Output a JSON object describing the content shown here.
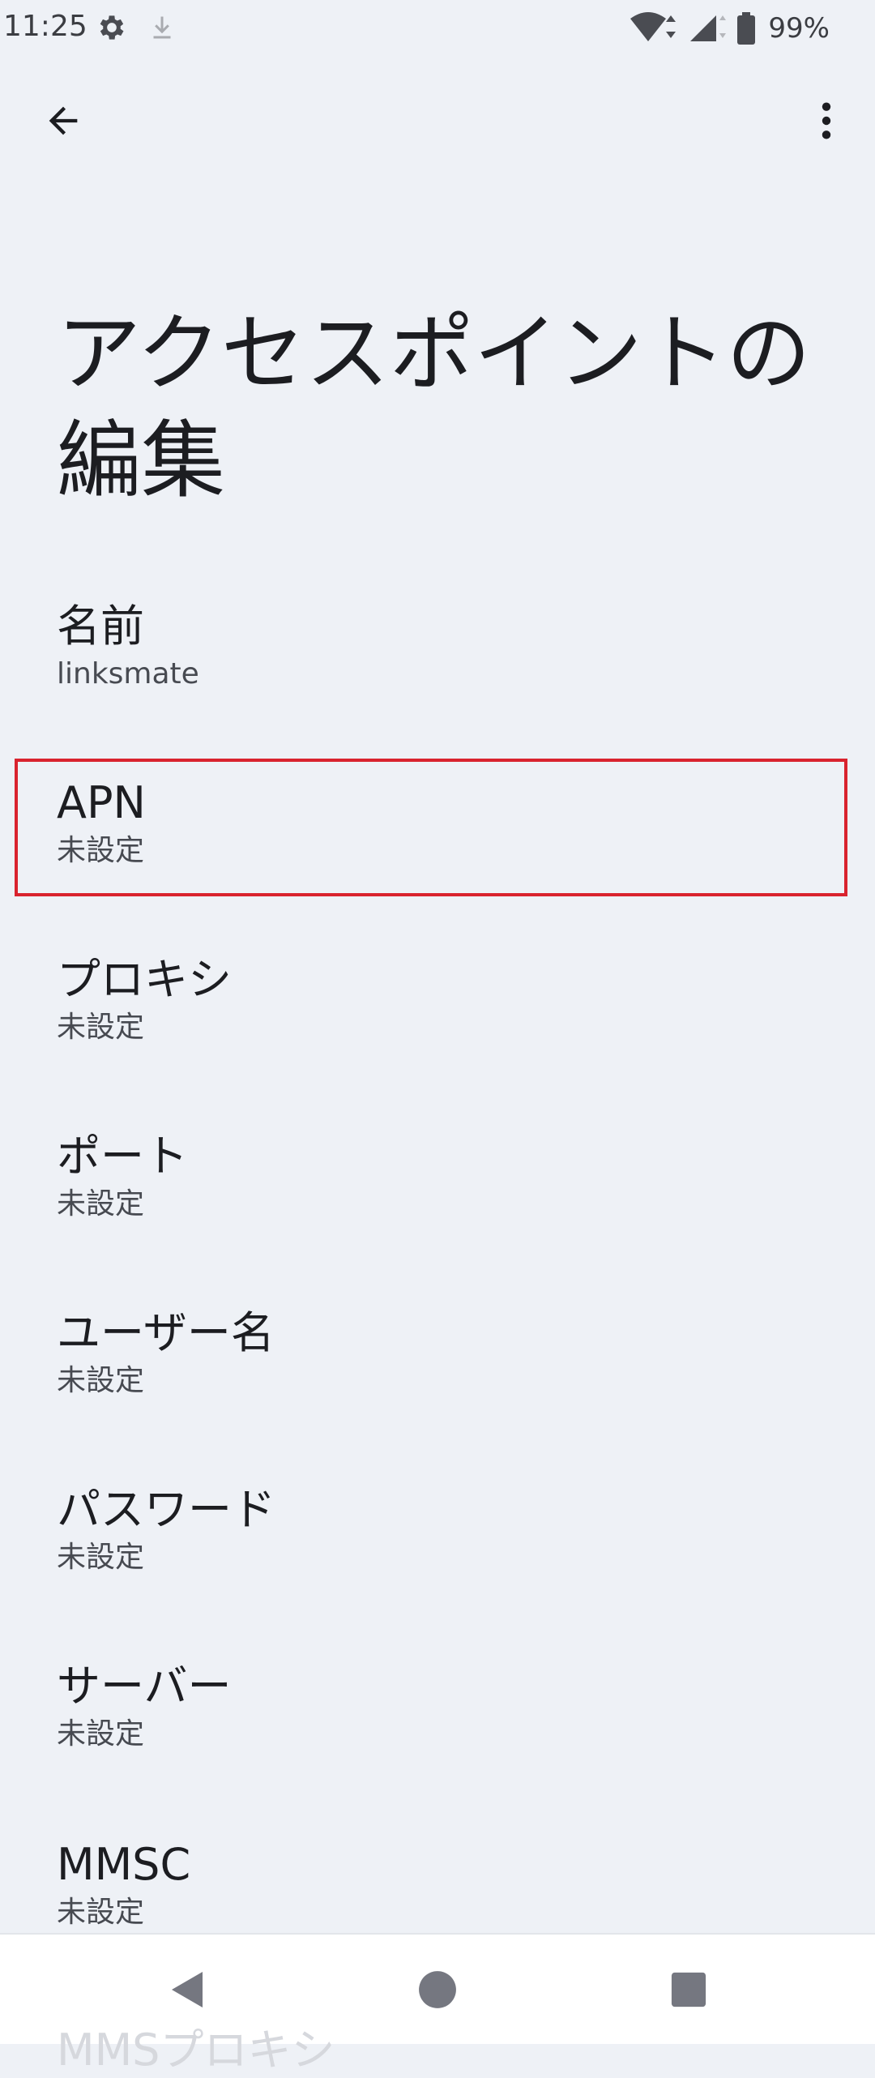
{
  "status_bar": {
    "time": "11:25",
    "battery": "99%",
    "icons": [
      "gear-icon",
      "download-icon",
      "wifi-icon",
      "signal-icon",
      "battery-icon"
    ]
  },
  "app_bar": {
    "back_icon": "arrow-back-icon",
    "menu_icon": "more-vert-icon"
  },
  "page": {
    "title": "アクセスポイントの編集"
  },
  "preferences": [
    {
      "title": "名前",
      "summary": "linksmate"
    },
    {
      "title": "APN",
      "summary": "未設定"
    },
    {
      "title": "プロキシ",
      "summary": "未設定"
    },
    {
      "title": "ポート",
      "summary": "未設定"
    },
    {
      "title": "ユーザー名",
      "summary": "未設定"
    },
    {
      "title": "パスワード",
      "summary": "未設定"
    },
    {
      "title": "サーバー",
      "summary": "未設定"
    },
    {
      "title": "MMSC",
      "summary": "未設定"
    }
  ],
  "partially_hidden_item": "MMSプロキシ",
  "highlight_color": "#d9232e",
  "navigation_bar": {
    "icons": [
      "nav-back-icon",
      "nav-home-icon",
      "nav-recents-icon"
    ]
  }
}
